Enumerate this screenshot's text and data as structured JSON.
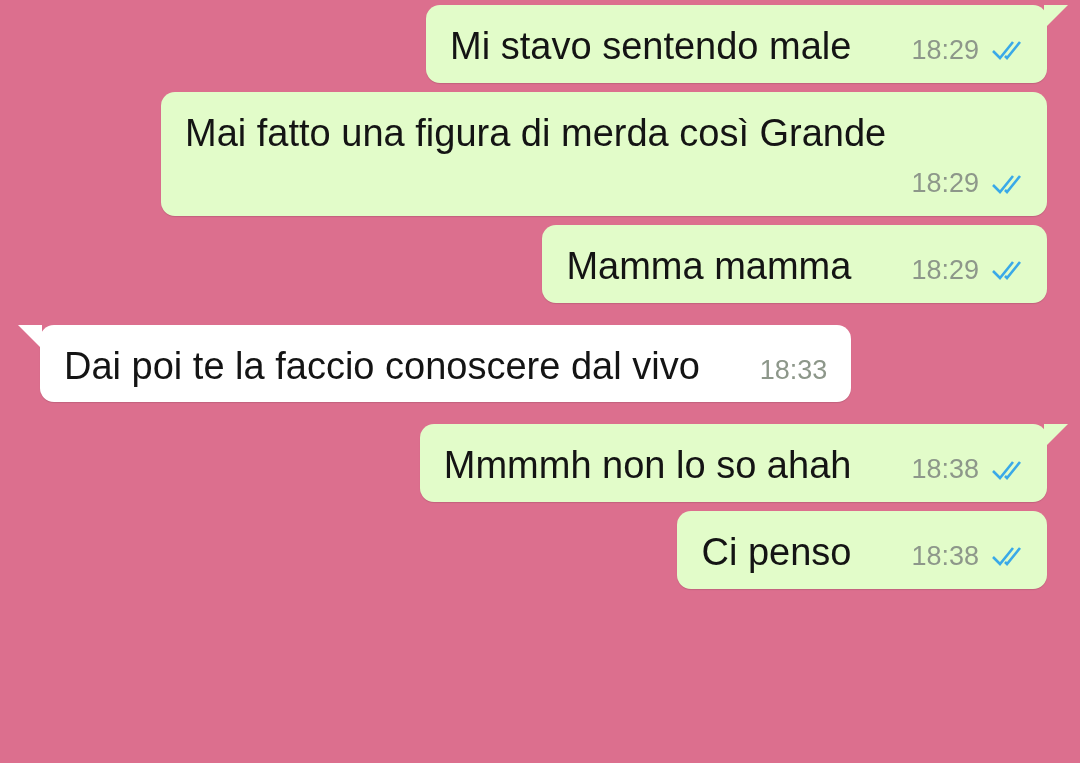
{
  "messages": [
    {
      "kind": "outgoing",
      "text": "Mi stavo sentendo male",
      "time": "18:29",
      "read": true,
      "tail": true
    },
    {
      "kind": "outgoing",
      "text": "Mai fatto una figura di merda così Grande",
      "time": "18:29",
      "read": true,
      "tail": false
    },
    {
      "kind": "outgoing",
      "text": "Mamma mamma",
      "time": "18:29",
      "read": true,
      "tail": false
    },
    {
      "kind": "incoming",
      "text": "Dai poi te la faccio conoscere dal vivo",
      "time": "18:33",
      "tail": true
    },
    {
      "kind": "outgoing",
      "text": "Mmmmh non lo so ahah",
      "time": "18:38",
      "read": true,
      "tail": true
    },
    {
      "kind": "outgoing",
      "text": "Ci penso",
      "time": "18:38",
      "read": true,
      "tail": false
    }
  ]
}
